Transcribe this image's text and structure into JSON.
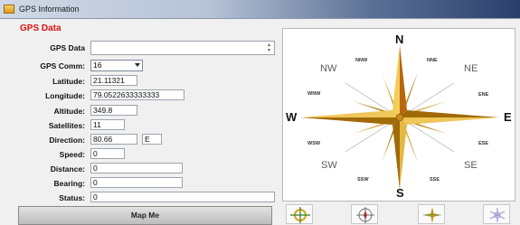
{
  "window": {
    "title": "GPS Information"
  },
  "section_header": "GPS Data",
  "fields": {
    "gps_data": {
      "label": "GPS Data",
      "value": ""
    },
    "gps_comm": {
      "label": "GPS Comm:",
      "value": "16"
    },
    "latitude": {
      "label": "Latitude:",
      "value": "21.11321"
    },
    "longitude": {
      "label": "Longitude:",
      "value": "79.0522633333333"
    },
    "altitude": {
      "label": "Altitude:",
      "value": "349.8"
    },
    "satellites": {
      "label": "Satellites:",
      "value": "11"
    },
    "direction": {
      "label": "Direction:",
      "value": "80.66",
      "heading": "E"
    },
    "speed": {
      "label": "Speed:",
      "value": "0"
    },
    "distance": {
      "label": "Distance:",
      "value": "0"
    },
    "bearing": {
      "label": "Bearing:",
      "value": "0"
    },
    "status": {
      "label": "Status:",
      "value": "0"
    }
  },
  "compass": {
    "cardinals": {
      "n": "N",
      "s": "S",
      "e": "E",
      "w": "W"
    },
    "intercardinals": {
      "nw": "NW",
      "ne": "NE",
      "sw": "SW",
      "se": "SE"
    },
    "minor": {
      "nnw": "NNW",
      "nne": "NNE",
      "wnw": "WNW",
      "ene": "ENE",
      "wsw": "WSW",
      "ese": "ESE",
      "ssw": "SSW",
      "sse": "SSE"
    }
  },
  "buttons": {
    "map_me": "Map Me"
  },
  "icon_buttons": [
    "crosshair-target-icon",
    "compass-dial-icon",
    "compass-rose-icon",
    "snowflake-compass-icon"
  ],
  "colors": {
    "header_red": "#e01010",
    "compass_gold": "#d9a520",
    "compass_dark": "#8a5a00"
  }
}
